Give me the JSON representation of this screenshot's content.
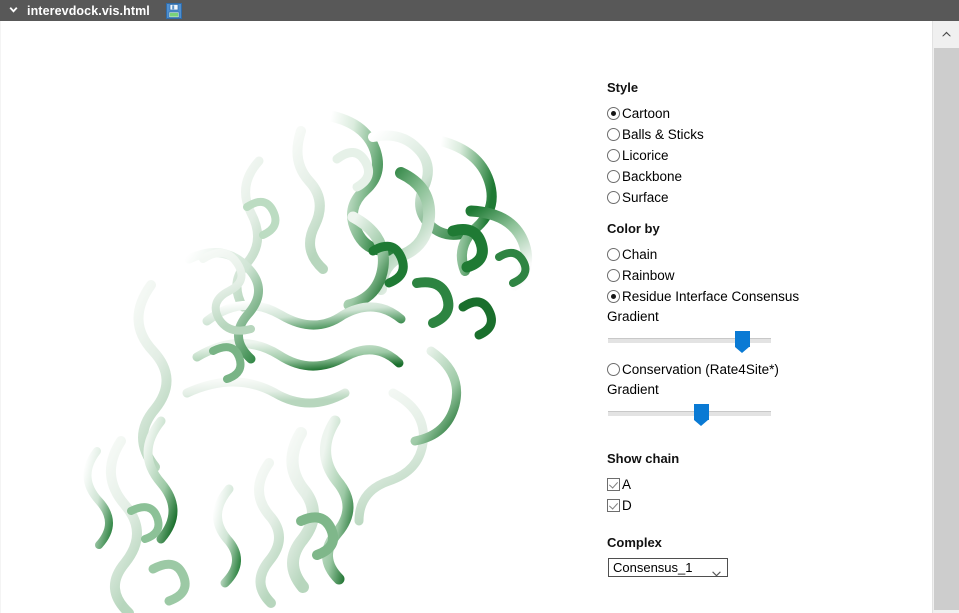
{
  "window": {
    "title": "interevdock.vis.html",
    "chevron_icon": "chevron-down-icon",
    "save_icon": "floppy-disk-save-icon"
  },
  "viewer": {
    "name": "molecular-structure-viewer",
    "representation": "cartoon ribbon",
    "description": "Protein complex cartoon ribbon rendering colored white-to-green by residue interface consensus"
  },
  "panel": {
    "style": {
      "title": "Style",
      "options": [
        {
          "label": "Cartoon",
          "selected": true
        },
        {
          "label": "Balls & Sticks",
          "selected": false
        },
        {
          "label": "Licorice",
          "selected": false
        },
        {
          "label": "Backbone",
          "selected": false
        },
        {
          "label": "Surface",
          "selected": false
        }
      ]
    },
    "color_by": {
      "title": "Color by",
      "options": [
        {
          "label": "Chain",
          "selected": false
        },
        {
          "label": "Rainbow",
          "selected": false
        },
        {
          "label": "Residue Interface Consensus",
          "selected": true
        },
        {
          "label": "Conservation (Rate4Site*)",
          "selected": false
        }
      ],
      "consensus_gradient": {
        "label": "Gradient",
        "value_percent": 82
      },
      "conservation_gradient": {
        "label": "Gradient",
        "value_percent": 57
      }
    },
    "show_chain": {
      "title": "Show chain",
      "chains": [
        {
          "label": "A",
          "checked": true
        },
        {
          "label": "D",
          "checked": true
        }
      ]
    },
    "complex": {
      "title": "Complex",
      "selected": "Consensus_1"
    }
  },
  "scrollbar": {
    "up_arrow_icon": "chevron-up-icon"
  },
  "colors": {
    "titlebar": "#585858",
    "accent_blue": "#0a7ad4",
    "structure_green": "#1f7a34",
    "structure_white": "#f4f4f4",
    "scrollbar_thumb": "#cdcdcd"
  }
}
